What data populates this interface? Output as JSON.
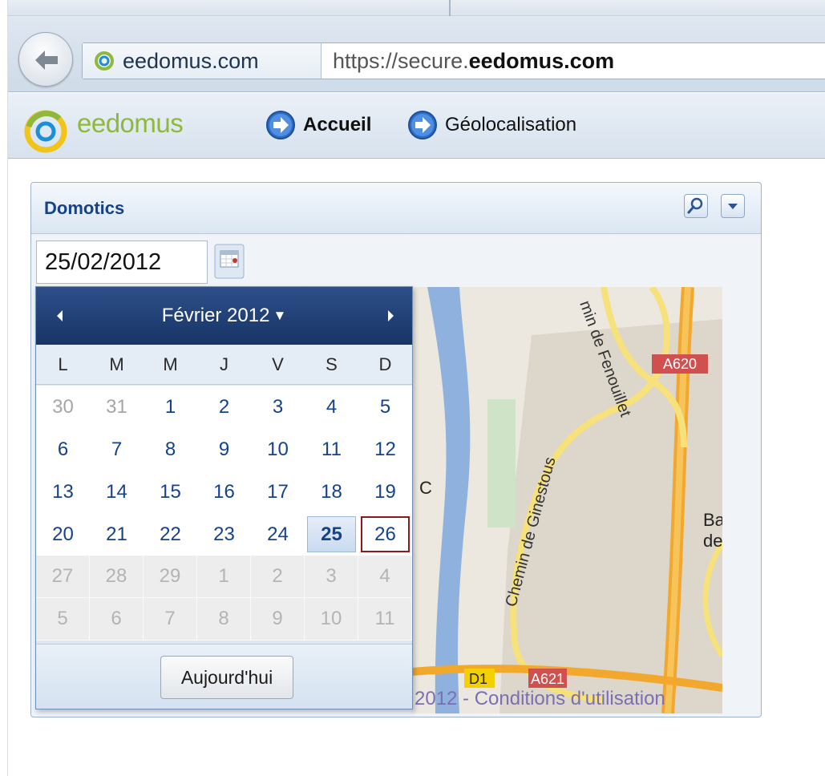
{
  "browser": {
    "site_identity": "eedomus.com",
    "url_prefix": "https://secure.",
    "url_domain": "eedomus.com"
  },
  "app": {
    "logo_text": "eedomus",
    "nav": [
      {
        "label": "Accueil",
        "icon": "arrow-right-circle-icon"
      },
      {
        "label": "Géolocalisation",
        "icon": "arrow-right-circle-icon"
      }
    ]
  },
  "widget": {
    "title": "Domotics",
    "date_value": "25/02/2012",
    "tools": [
      "search-icon",
      "chevron-down-icon"
    ]
  },
  "datepicker": {
    "month_label": "Février 2012",
    "weekdays": [
      "L",
      "M",
      "M",
      "J",
      "V",
      "S",
      "D"
    ],
    "weeks": [
      [
        "30",
        "31",
        "1",
        "2",
        "3",
        "4",
        "5"
      ],
      [
        "6",
        "7",
        "8",
        "9",
        "10",
        "11",
        "12"
      ],
      [
        "13",
        "14",
        "15",
        "16",
        "17",
        "18",
        "19"
      ],
      [
        "20",
        "21",
        "22",
        "23",
        "24",
        "25",
        "26"
      ],
      [
        "27",
        "28",
        "29",
        "1",
        "2",
        "3",
        "4"
      ],
      [
        "5",
        "6",
        "7",
        "8",
        "9",
        "10",
        "11"
      ]
    ],
    "selected_day": "25",
    "today_day": "26",
    "today_button": "Aujourd'hui"
  },
  "map": {
    "labels": [
      "min de Fenouillet",
      "A620",
      "Chemin de Ginestous",
      "C",
      "Ba",
      "de",
      "D1",
      "A621"
    ],
    "copyright": "2012 - Conditions d'utilisation"
  },
  "colors": {
    "accent": "#15428b",
    "header_dark": "#173466",
    "logo_green": "#8fb83d",
    "today_border": "#8b1a1a"
  }
}
